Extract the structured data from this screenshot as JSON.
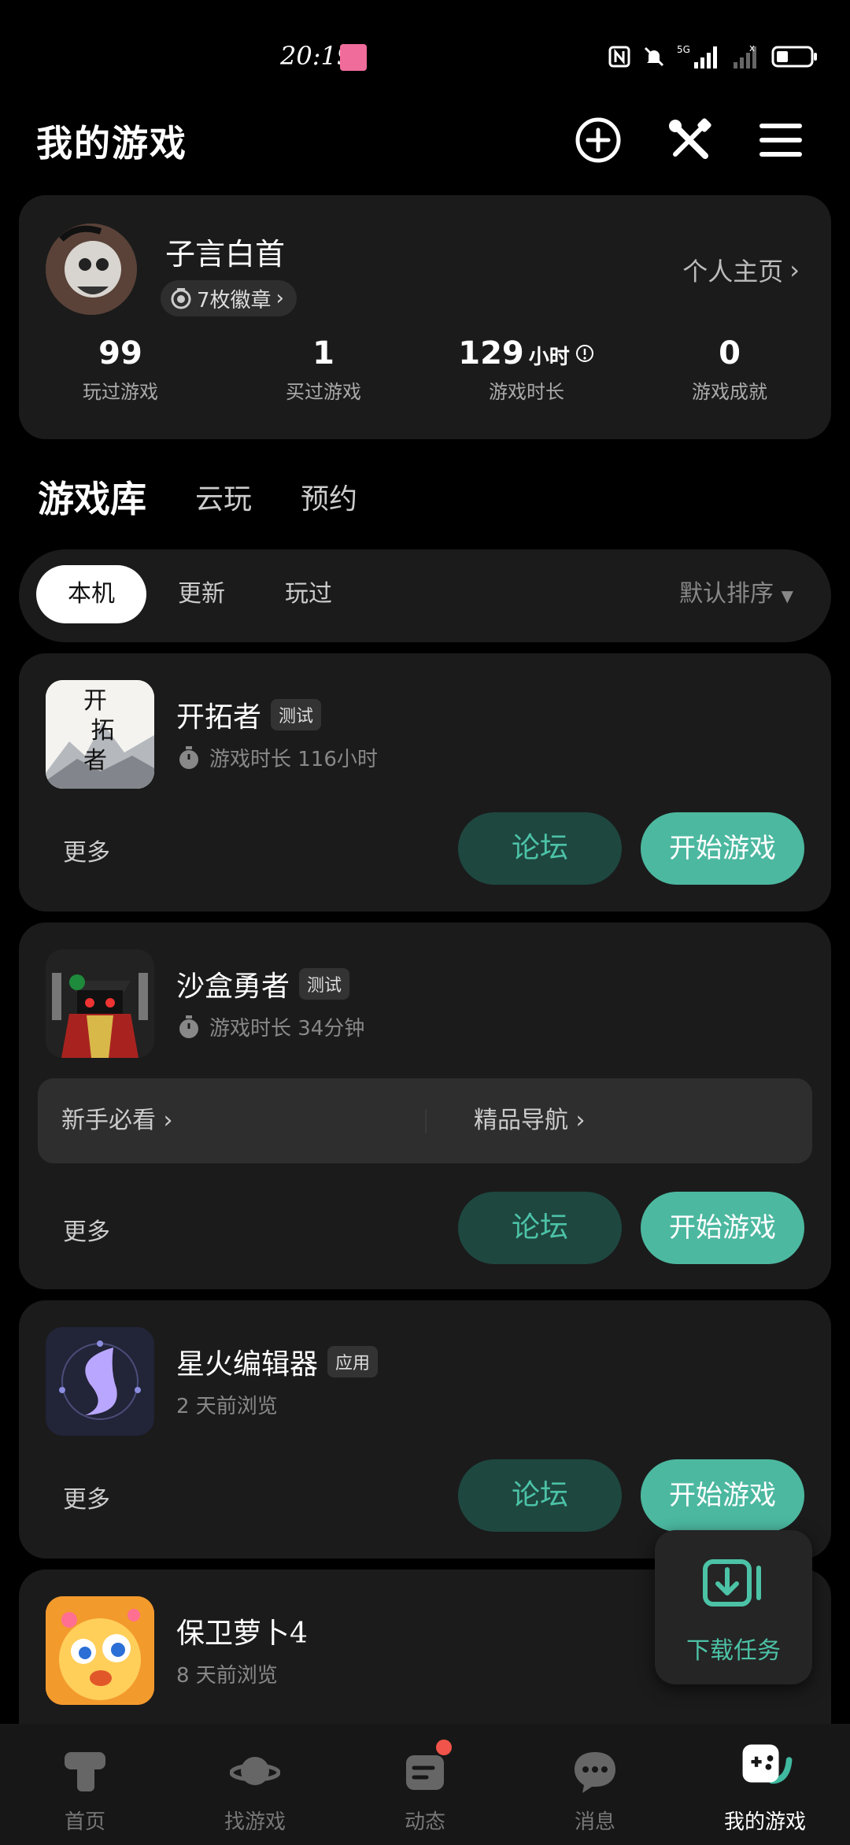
{
  "status_bar": {
    "time": "20:19",
    "app_indicator": "bilibili",
    "icons": [
      "nfc-icon",
      "bell-muted-icon",
      "signal-5g-icon",
      "signal-icon",
      "battery-icon"
    ]
  },
  "header": {
    "title": "我的游戏",
    "actions": [
      "add-circle-icon",
      "tools-icon",
      "menu-icon"
    ]
  },
  "profile": {
    "username": "子言白首",
    "badges": "7枚徽章",
    "home_link": "个人主页",
    "stats": [
      {
        "value": "99",
        "unit": "",
        "label": "玩过游戏"
      },
      {
        "value": "1",
        "unit": "",
        "label": "买过游戏"
      },
      {
        "value": "129",
        "unit": "小时",
        "label": "游戏时长"
      },
      {
        "value": "0",
        "unit": "",
        "label": "游戏成就"
      }
    ]
  },
  "tabs": [
    "游戏库",
    "云玩",
    "预约"
  ],
  "filters": {
    "chips": [
      "本机",
      "更新",
      "玩过"
    ],
    "sort": "默认排序"
  },
  "games": [
    {
      "name": "开拓者",
      "tag": "测试",
      "meta": "游戏时长 116小时",
      "icon_text": "开\n拓\n者",
      "more": "更多",
      "forum": "论坛",
      "play": "开始游戏"
    },
    {
      "name": "沙盒勇者",
      "tag": "测试",
      "meta": "游戏时长 34分钟",
      "quick_links": [
        "新手必看",
        "精品导航"
      ],
      "more": "更多",
      "forum": "论坛",
      "play": "开始游戏"
    },
    {
      "name": "星火编辑器",
      "tag": "应用",
      "meta": "2 天前浏览",
      "more": "更多",
      "forum": "论坛",
      "play": "开始游戏"
    },
    {
      "name": "保卫萝卜4",
      "tag": "",
      "meta": "8 天前浏览"
    }
  ],
  "download_fab": {
    "label": "下载任务"
  },
  "bottom_nav": [
    {
      "label": "首页",
      "icon": "home-icon"
    },
    {
      "label": "找游戏",
      "icon": "planet-icon"
    },
    {
      "label": "动态",
      "icon": "feed-icon"
    },
    {
      "label": "消息",
      "icon": "message-icon"
    },
    {
      "label": "我的游戏",
      "icon": "gamepad-icon",
      "active": true
    }
  ],
  "colors": {
    "accent": "#4cb8a0",
    "forum_bg": "#1e4740",
    "card_bg": "#1b1b1b",
    "notification": "#f0544a"
  }
}
